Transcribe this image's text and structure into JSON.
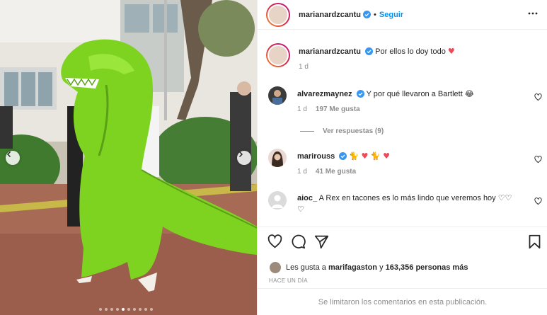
{
  "post": {
    "username": "marianardzcantu",
    "follow_label": "Seguir",
    "caption": "Por ellos lo doy todo",
    "caption_emoji": "♥",
    "caption_age": "1 d"
  },
  "comments": [
    {
      "username": "alvarezmaynez",
      "text": "Y por qué llevaron a Bartlett",
      "emoji": "😂",
      "age": "1 d",
      "likes": "197 Me gusta",
      "replies": "Ver respuestas (9)"
    },
    {
      "username": "marirouss",
      "text": "",
      "emoji": "🐈 ♥ 🐈 ♥",
      "age": "1 d",
      "likes": "41 Me gusta"
    },
    {
      "username": "aioc_",
      "text": "A Rex en tacones es lo más lindo que veremos hoy ♡♡",
      "text2": "♡"
    }
  ],
  "likes_summary": {
    "prefix": "Les gusta a",
    "user": "marifagaston",
    "middle": "y",
    "count": "163,356 personas más"
  },
  "post_date": "HACE UN DÍA",
  "comments_limited": "Se limitaron los comentarios en esta publicación.",
  "carousel": {
    "total": 10,
    "active": 5
  },
  "colors": {
    "accent": "#0095f6",
    "verified": "#3897f0",
    "heart": "#ed4956",
    "dino": "#7ed321"
  },
  "icons": [
    "chevron-left-icon",
    "chevron-right-icon",
    "more-icon",
    "verified-icon",
    "heart-icon",
    "comment-icon",
    "share-icon",
    "bookmark-icon"
  ]
}
